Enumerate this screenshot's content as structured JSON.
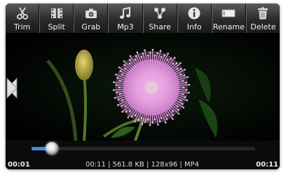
{
  "toolbar": {
    "items": [
      {
        "label": "Trim",
        "icon": "scissors-icon"
      },
      {
        "label": "Split",
        "icon": "split-film-icon"
      },
      {
        "label": "Grab",
        "icon": "camera-icon"
      },
      {
        "label": "Mp3",
        "icon": "music-note-icon"
      },
      {
        "label": "Share",
        "icon": "share-icon"
      },
      {
        "label": "Info",
        "icon": "info-icon"
      },
      {
        "label": "Rename",
        "icon": "rename-icon"
      },
      {
        "label": "Delete",
        "icon": "trash-icon"
      }
    ]
  },
  "player": {
    "current_time": "00:01",
    "end_time": "00:11",
    "file_info": "00:11 | 561.8 KB | 128x96 | MP4",
    "progress_fraction": 0.09,
    "accent_color": "#3a8ee6"
  },
  "navigation": {
    "previous_icon": "chevron-left-icon",
    "next_icon": "chevron-right-icon"
  }
}
